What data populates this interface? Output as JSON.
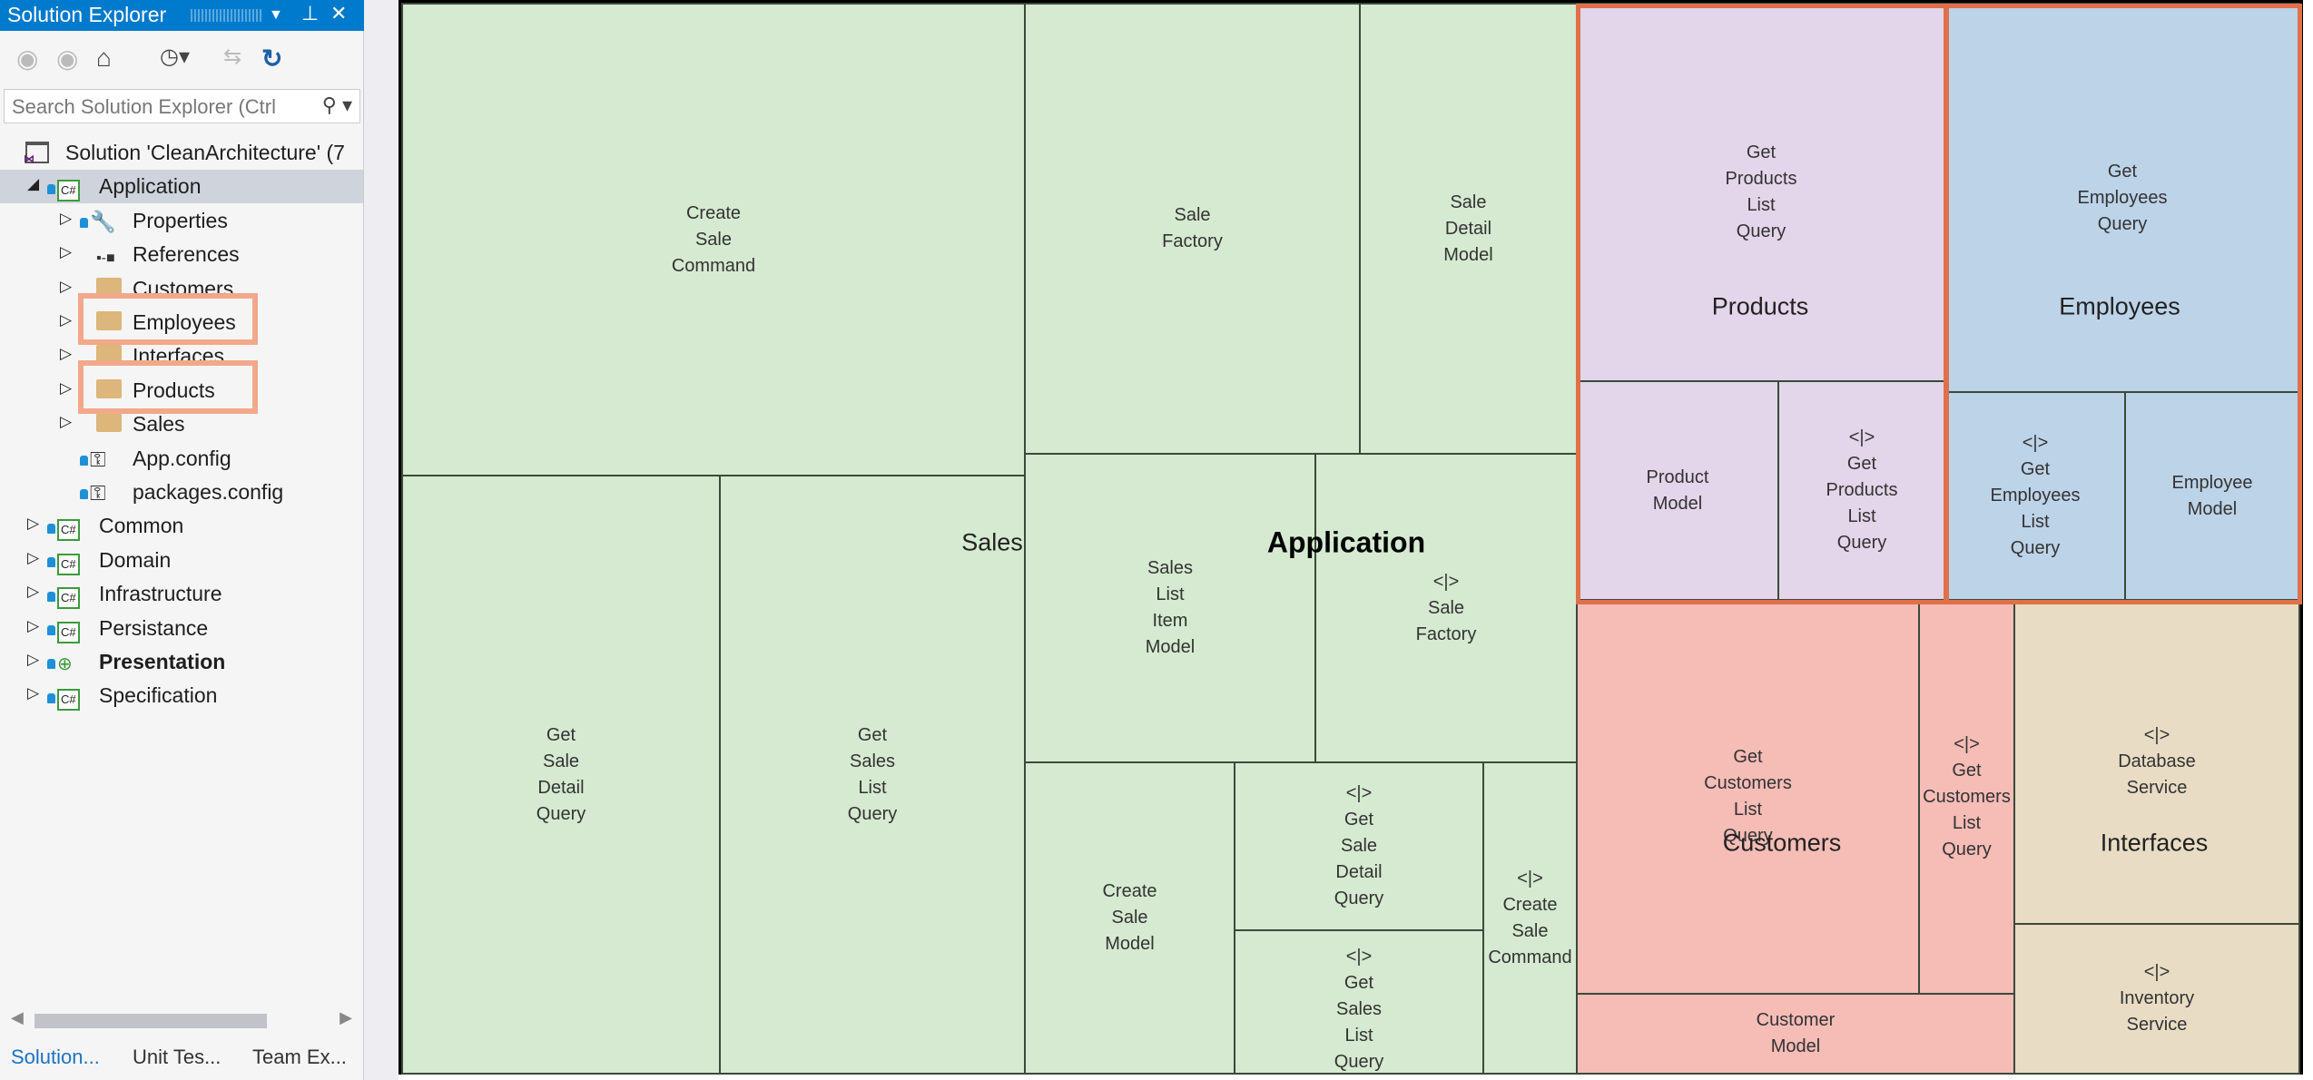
{
  "solution_explorer": {
    "title": "Solution Explorer",
    "search_placeholder": "Search Solution Explorer (Ctrl",
    "toolbar_icons": [
      "back-icon",
      "forward-icon",
      "home-icon",
      "pending-changes-icon",
      "sync-icon",
      "refresh-icon"
    ],
    "tree": [
      {
        "label": "Solution 'CleanArchitecture' (7",
        "level": 0,
        "icon": "solution-icon",
        "toggle": "none"
      },
      {
        "label": "Application",
        "level": 1,
        "icon": "csharp-project-icon",
        "toggle": "expanded",
        "selected": true
      },
      {
        "label": "Properties",
        "level": 2,
        "icon": "wrench-icon",
        "toggle": "collapsed"
      },
      {
        "label": "References",
        "level": 2,
        "icon": "references-icon",
        "toggle": "collapsed"
      },
      {
        "label": "Customers",
        "level": 2,
        "icon": "folder-icon",
        "toggle": "collapsed"
      },
      {
        "label": "Employees",
        "level": 2,
        "icon": "folder-icon",
        "toggle": "collapsed",
        "highlighted": true
      },
      {
        "label": "Interfaces",
        "level": 2,
        "icon": "folder-icon",
        "toggle": "collapsed"
      },
      {
        "label": "Products",
        "level": 2,
        "icon": "folder-icon",
        "toggle": "collapsed",
        "highlighted": true
      },
      {
        "label": "Sales",
        "level": 2,
        "icon": "folder-icon",
        "toggle": "collapsed"
      },
      {
        "label": "App.config",
        "level": 2,
        "icon": "config-file-icon",
        "toggle": "none"
      },
      {
        "label": "packages.config",
        "level": 2,
        "icon": "config-file-icon",
        "toggle": "none"
      },
      {
        "label": "Common",
        "level": 1,
        "icon": "csharp-project-icon",
        "toggle": "collapsed"
      },
      {
        "label": "Domain",
        "level": 1,
        "icon": "csharp-project-icon",
        "toggle": "collapsed"
      },
      {
        "label": "Infrastructure",
        "level": 1,
        "icon": "csharp-project-icon",
        "toggle": "collapsed"
      },
      {
        "label": "Persistance",
        "level": 1,
        "icon": "csharp-project-icon",
        "toggle": "collapsed"
      },
      {
        "label": "Presentation",
        "level": 1,
        "icon": "web-project-icon",
        "toggle": "collapsed",
        "bold": true
      },
      {
        "label": "Specification",
        "level": 1,
        "icon": "csharp-project-icon",
        "toggle": "collapsed"
      }
    ],
    "tabs": [
      "Solution...",
      "Unit Tes...",
      "Team Ex..."
    ],
    "active_tab": 0
  },
  "treemap": {
    "root_label": "Application",
    "groups": {
      "sales": {
        "label": "Sales",
        "color": "#d5ead0",
        "cells": [
          "Create\nSale\nCommand",
          "Get\nSale\nDetail\nQuery",
          "Get\nSales\nList\nQuery",
          "Sale\nFactory",
          "Sale\nDetail\nModel",
          "Sales\nList\nItem\nModel",
          "<|>\nSale\nFactory",
          "Create\nSale\nModel",
          "<|>\nGet\nSale\nDetail\nQuery",
          "<|>\nGet\nSales\nList\nQuery",
          "<|>\nCreate\nSale\nCommand"
        ]
      },
      "products": {
        "label": "Products",
        "color": "#e3d5ea",
        "highlighted": true,
        "cells": [
          "Get\nProducts\nList\nQuery",
          "Product\nModel",
          "<|>\nGet\nProducts\nList\nQuery"
        ]
      },
      "employees": {
        "label": "Employees",
        "color": "#bcd3e8",
        "highlighted": true,
        "cells": [
          "Get\nEmployees\nQuery",
          "<|>\nGet\nEmployees\nList\nQuery",
          "Employee\nModel"
        ]
      },
      "customers": {
        "label": "Customers",
        "color": "#f6bcb6",
        "cells": [
          "Get\nCustomers\nList\nQuery",
          "<|>\nGet\nCustomers\nList\nQuery",
          "Customer\nModel"
        ]
      },
      "interfaces": {
        "label": "Interfaces",
        "color": "#e8dcc4",
        "cells": [
          "<|>\nDatabase\nService",
          "<|>\nInventory\nService"
        ]
      }
    },
    "highlight_color": "#e0704a"
  }
}
